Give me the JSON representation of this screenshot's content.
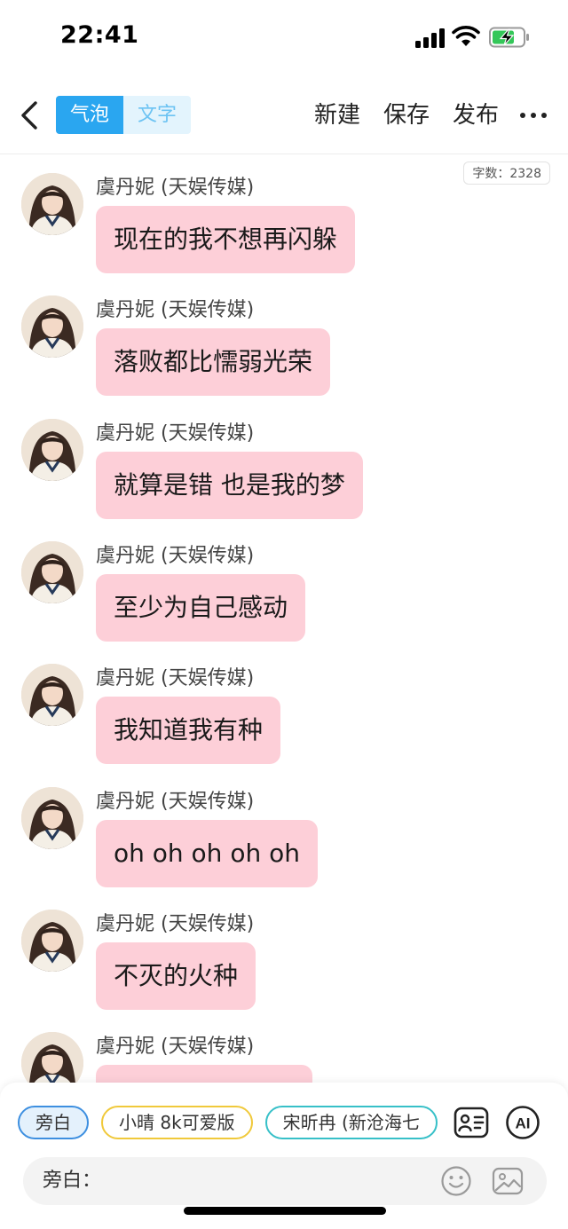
{
  "status_bar": {
    "time": "22:41",
    "battery_state": "charging",
    "battery_color": "#34c759"
  },
  "nav": {
    "back_icon": "chevron-left-icon",
    "tabs": [
      {
        "label": "气泡",
        "active": true
      },
      {
        "label": "文字",
        "active": false
      }
    ],
    "actions": {
      "new_label": "新建",
      "save_label": "保存",
      "publish_label": "发布",
      "more_icon": "more-horizontal-icon"
    }
  },
  "chat": {
    "word_count": "字数：2328",
    "bubble_color": "#fdcfd8",
    "messages": [
      {
        "sender": "虞丹妮 (天娱传媒)",
        "text": "现在的我不想再闪躲"
      },
      {
        "sender": "虞丹妮 (天娱传媒)",
        "text": "落败都比懦弱光荣"
      },
      {
        "sender": "虞丹妮 (天娱传媒)",
        "text": "就算是错 也是我的梦"
      },
      {
        "sender": "虞丹妮 (天娱传媒)",
        "text": "至少为自己感动"
      },
      {
        "sender": "虞丹妮 (天娱传媒)",
        "text": "我知道我有种"
      },
      {
        "sender": "虞丹妮 (天娱传媒)",
        "text": "oh oh oh oh oh"
      },
      {
        "sender": "虞丹妮 (天娱传媒)",
        "text": "不灭的火种"
      },
      {
        "sender": "虞丹妮 (天娱传媒)",
        "text": ""
      }
    ]
  },
  "bottom": {
    "roles": [
      {
        "label": "旁白",
        "active": true
      },
      {
        "label": "小晴 8k可爱版",
        "active": false
      },
      {
        "label": "宋昕冉 (新沧海七",
        "active": false
      }
    ],
    "contact_icon": "contact-card-icon",
    "ai_label": "AI",
    "input_label": "旁白：",
    "input_value": "",
    "emoji_icon": "emoji-icon",
    "image_icon": "image-icon"
  }
}
